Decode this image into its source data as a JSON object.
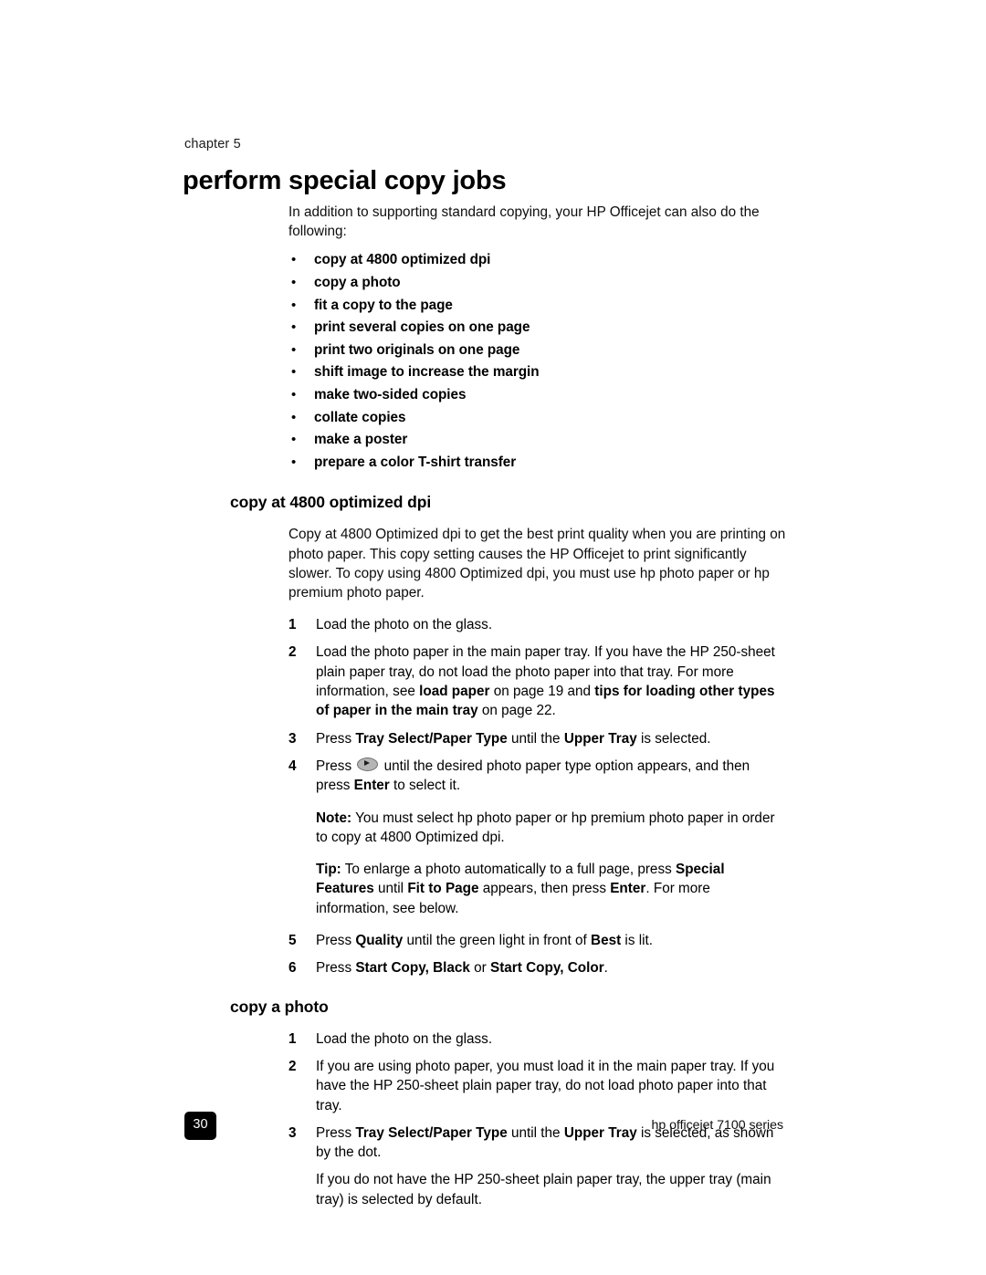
{
  "document": {
    "chapter_label": "chapter  5",
    "chapter_title": "perform special copy jobs",
    "footer_page_number": "30",
    "footer_product": "hp officejet 7100 series"
  },
  "intro": {
    "text": "In addition to supporting standard copying, your HP Officejet can also do the following:"
  },
  "bullets": [
    {
      "marker": "•",
      "label": "copy at 4800 optimized dpi"
    },
    {
      "marker": "•",
      "label": "copy a photo"
    },
    {
      "marker": "•",
      "label": "fit a copy to the page"
    },
    {
      "marker": "•",
      "label": "print several copies on one page"
    },
    {
      "marker": "•",
      "label": "print two originals on one page"
    },
    {
      "marker": "•",
      "label": "shift image to increase the margin"
    },
    {
      "marker": "•",
      "label": "make two-sided copies"
    },
    {
      "marker": "•",
      "label": "collate copies"
    },
    {
      "marker": "•",
      "label": "make a poster"
    },
    {
      "marker": "•",
      "label": "prepare a color T-shirt transfer"
    }
  ],
  "section_4800": {
    "heading": "copy at 4800 optimized dpi",
    "intro": "Copy at 4800 Optimized dpi to get the best print quality when you are printing on photo paper. This copy setting causes the HP Officejet to print significantly slower. To copy using 4800 Optimized dpi, you must use hp photo paper or hp premium photo paper.",
    "step1_num": "1",
    "step1_text": "Load the photo on the glass.",
    "step2_num": "2",
    "step2_a": "Load the photo paper in the main paper tray. If you have the HP 250-sheet plain paper tray, do not load the photo paper into that tray. For more information, see ",
    "step2_b_bold": "load paper",
    "step2_c": " on page 19 and ",
    "step2_d_bold": "tips for loading other types of paper in the main tray",
    "step2_e": " on page 22.",
    "step3_num": "3",
    "step3_a": "Press ",
    "step3_b_bold": "Tray Select/Paper Type",
    "step3_c": " until the ",
    "step3_d_bold": "Upper Tray",
    "step3_e": " is selected.",
    "step4_num": "4",
    "step4_a": "Press ",
    "step4_icon": "right-arrow-button-icon",
    "step4_b": " until the desired photo paper type option appears, and then press ",
    "step4_c_bold": "Enter",
    "step4_d": " to select it.",
    "note_label": "Note:",
    "note_text": "  You must select hp photo paper or hp premium photo paper in order to copy at 4800 Optimized dpi.",
    "tip_label": "Tip:",
    "tip_a": "  To enlarge a photo automatically to a full page, press ",
    "tip_b_bold": "Special Features",
    "tip_c": " until ",
    "tip_d_bold": "Fit to Page",
    "tip_e": " appears, then press ",
    "tip_f_bold": "Enter",
    "tip_g": ". For more information, see below.",
    "step5_num": "5",
    "step5_a": "Press ",
    "step5_b_bold": "Quality",
    "step5_c": " until the green light in front of ",
    "step5_d_bold": "Best",
    "step5_e": " is lit.",
    "step6_num": "6",
    "step6_a": "Press ",
    "step6_b_bold": "Start Copy, Black",
    "step6_c": " or ",
    "step6_d_bold": "Start Copy, Color",
    "step6_e": "."
  },
  "section_photo": {
    "heading": "copy a photo",
    "step1_num": "1",
    "step1_text": "Load the photo on the glass.",
    "step2_num": "2",
    "step2_text": "If you are using photo paper, you must load it in the main paper tray. If you have the HP 250-sheet plain paper tray, do not load photo paper into that tray.",
    "step3_num": "3",
    "step3_a": "Press ",
    "step3_b_bold": "Tray Select/Paper Type",
    "step3_c": " until the ",
    "step3_d_bold": "Upper Tray",
    "step3_e": " is selected, as shown by the dot.",
    "step3_follow": "If you do not have the HP 250-sheet plain paper tray, the upper tray (main tray) is selected by default."
  }
}
